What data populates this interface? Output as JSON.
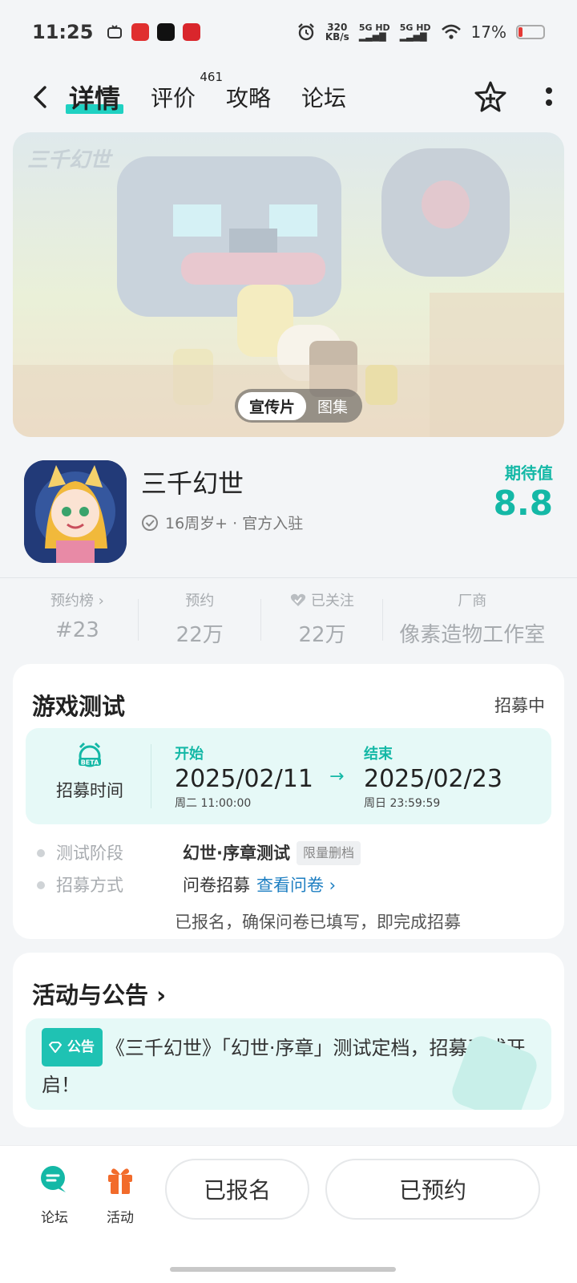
{
  "status_bar": {
    "time": "11:25",
    "net_speed_value": "320",
    "net_speed_unit": "KB/s",
    "sim1": "5G HD",
    "sim2": "5G HD",
    "battery": "17%"
  },
  "nav": {
    "tabs": [
      {
        "label": "详情",
        "active": true
      },
      {
        "label": "评价",
        "badge": "461"
      },
      {
        "label": "攻略"
      },
      {
        "label": "论坛"
      }
    ]
  },
  "banner": {
    "logo_text": "三千幻世",
    "toggle": [
      "宣传片",
      "图集"
    ]
  },
  "game": {
    "title": "三千幻世",
    "meta": "16周岁+ · 官方入驻",
    "expect_label": "期待值",
    "expect_score": "8.8"
  },
  "stats": [
    {
      "label": "预约榜 ›",
      "value": "#23"
    },
    {
      "label": "预约",
      "value": "22万"
    },
    {
      "label": "已关注",
      "value": "22万"
    },
    {
      "label": "厂商",
      "value": "像素造物工作室"
    }
  ],
  "test_card": {
    "title": "游戏测试",
    "status": "招募中",
    "recruit_icon_text": "BETA",
    "recruit_label": "招募时间",
    "start": {
      "label": "开始",
      "date": "2025/02/11",
      "sub": "周二  11:00:00"
    },
    "end": {
      "label": "结束",
      "date": "2025/02/23",
      "sub": "周日  23:59:59"
    },
    "arrow": "→",
    "stage_key": "测试阶段",
    "stage_value": "幻世·序章测试",
    "stage_tag": "限量删档",
    "method_key": "招募方式",
    "method_value": "问卷招募",
    "method_link": "查看问卷 ›",
    "note": "已报名，确保问卷已填写，即完成招募"
  },
  "notice_card": {
    "title": "活动与公告 ›",
    "tag": "公告",
    "text": "《三千幻世》「幻世·序章」测试定档，招募正式开启！"
  },
  "bottom_bar": {
    "forum_label": "论坛",
    "activity_label": "活动",
    "signed_up": "已报名",
    "reserved": "已预约"
  },
  "colors": {
    "accent": "#14b8a6",
    "tab_highlight": "#1fd1c2",
    "link": "#1e7fc2",
    "gift": "#f26b2b"
  }
}
